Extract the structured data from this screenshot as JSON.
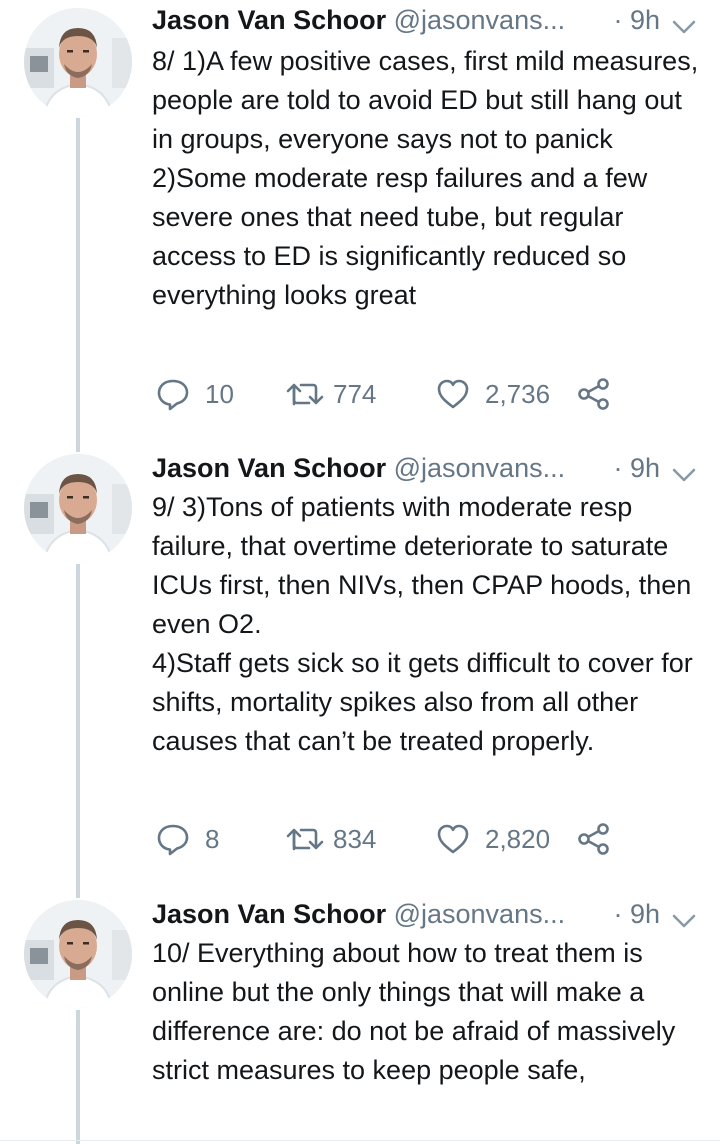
{
  "tweets": [
    {
      "name": "Jason Van Schoor",
      "handle": "@jasonvans...",
      "time": "· 9h",
      "lines": [
        "8/ 1)A few positive cases, first mild measures, people are told to avoid ED but still hang out in groups, everyone says not to panick",
        "2)Some moderate resp failures and a few severe ones that need tube, but regular access to ED is significantly reduced so everything looks great"
      ],
      "replies": "10",
      "retweets": "774",
      "likes": "2,736"
    },
    {
      "name": "Jason Van Schoor",
      "handle": "@jasonvans...",
      "time": "· 9h",
      "lines": [
        "9/ 3)Tons of patients with moderate resp failure, that overtime deteriorate to saturate ICUs first, then NIVs, then CPAP hoods, then even O2.",
        "4)Staff gets sick so it gets difficult to cover for shifts, mortality spikes also from all other causes that can’t be treated properly."
      ],
      "replies": "8",
      "retweets": "834",
      "likes": "2,820"
    },
    {
      "name": "Jason Van Schoor",
      "handle": "@jasonvans...",
      "time": "· 9h",
      "lines": [
        "10/ Everything about how to treat them is online but the only things that will make a difference are: do not be afraid of massively strict measures to keep people safe,"
      ]
    }
  ],
  "icons": {
    "reply": "reply-icon",
    "retweet": "retweet-icon",
    "like": "heart-icon",
    "share": "share-icon",
    "caret": "chevron-down-icon"
  },
  "colors": {
    "text": "#14171a",
    "secondary": "#657786",
    "thread_line": "#ccd6dd"
  }
}
